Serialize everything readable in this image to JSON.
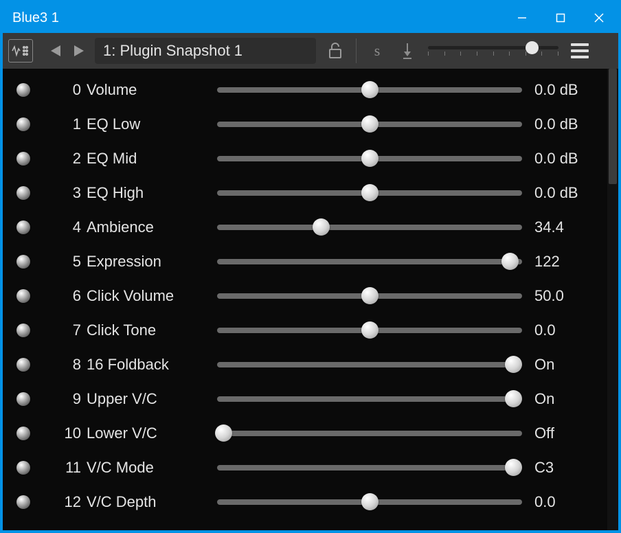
{
  "window": {
    "title": "Blue3 1"
  },
  "toolbar": {
    "snapshot_label": "1: Plugin Snapshot 1",
    "top_slider_pct": 80
  },
  "scrollbar_thumb_height_pct": 25,
  "params": [
    {
      "index": "0",
      "label": "Volume",
      "value": "0.0 dB",
      "pos": 50
    },
    {
      "index": "1",
      "label": "EQ Low",
      "value": "0.0 dB",
      "pos": 50
    },
    {
      "index": "2",
      "label": "EQ Mid",
      "value": "0.0 dB",
      "pos": 50
    },
    {
      "index": "3",
      "label": "EQ High",
      "value": "0.0 dB",
      "pos": 50
    },
    {
      "index": "4",
      "label": "Ambience",
      "value": "34.4",
      "pos": 34
    },
    {
      "index": "5",
      "label": "Expression",
      "value": "122",
      "pos": 96
    },
    {
      "index": "6",
      "label": "Click Volume",
      "value": "50.0",
      "pos": 50
    },
    {
      "index": "7",
      "label": "Click Tone",
      "value": "0.0",
      "pos": 50
    },
    {
      "index": "8",
      "label": "16 Foldback",
      "value": "On",
      "pos": 97
    },
    {
      "index": "9",
      "label": "Upper V/C",
      "value": "On",
      "pos": 97
    },
    {
      "index": "10",
      "label": "Lower V/C",
      "value": "Off",
      "pos": 2
    },
    {
      "index": "11",
      "label": "V/C Mode",
      "value": "C3",
      "pos": 97
    },
    {
      "index": "12",
      "label": "V/C Depth",
      "value": "0.0",
      "pos": 50
    }
  ]
}
